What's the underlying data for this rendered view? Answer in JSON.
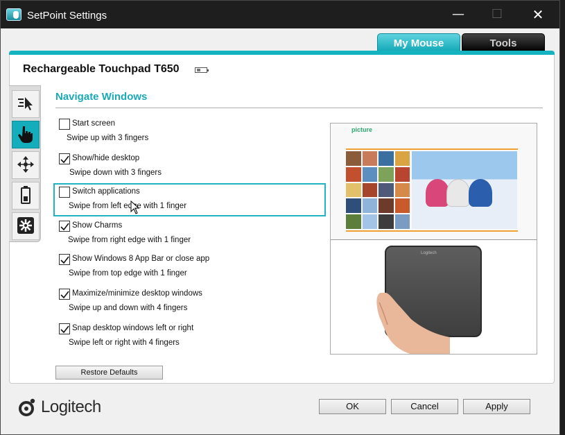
{
  "window": {
    "title": "SetPoint Settings",
    "controls": {
      "minimize": "—",
      "maximize": "☐",
      "close": "✕"
    }
  },
  "tabs": [
    {
      "label": "My Mouse",
      "active": true
    },
    {
      "label": "Tools",
      "active": false
    }
  ],
  "device": {
    "name": "Rechargeable Touchpad T650",
    "battery_icon": "battery-icon"
  },
  "sidebar": {
    "items": [
      {
        "icon": "pointer-speed-icon",
        "active": false
      },
      {
        "icon": "hand-gesture-icon",
        "active": true
      },
      {
        "icon": "scroll-move-icon",
        "active": false
      },
      {
        "icon": "battery-icon",
        "active": false
      },
      {
        "icon": "settings-gear-icon",
        "active": false
      }
    ]
  },
  "section": {
    "title": "Navigate Windows"
  },
  "options": [
    {
      "label": "Start screen",
      "desc": "Swipe up with 3 fingers",
      "checked": false
    },
    {
      "label": "Show/hide desktop",
      "desc": "Swipe down with 3 fingers",
      "checked": true
    },
    {
      "label": "Switch applications",
      "desc": "Swipe from left edge with 1 finger",
      "checked": false,
      "highlighted": true
    },
    {
      "label": "Show Charms",
      "desc": "Swipe from right edge with 1 finger",
      "checked": true
    },
    {
      "label": "Show Windows 8 App Bar or close app",
      "desc": "Swipe from top edge with 1 finger",
      "checked": true
    },
    {
      "label": "Maximize/minimize desktop windows",
      "desc": "Swipe up and down with 4 fingers",
      "checked": true
    },
    {
      "label": "Snap desktop windows left or right",
      "desc": "Swipe left or right with 4 fingers",
      "checked": true
    }
  ],
  "preview": {
    "app_name": "picture",
    "pad_brand": "Logitech"
  },
  "buttons": {
    "restore": "Restore Defaults",
    "ok": "OK",
    "cancel": "Cancel",
    "apply": "Apply"
  },
  "brand": {
    "logo_text": "Logitech"
  },
  "colors": {
    "accent": "#15b2bf",
    "titlebar": "#1e1e1e",
    "tools_tab": "#000000"
  }
}
